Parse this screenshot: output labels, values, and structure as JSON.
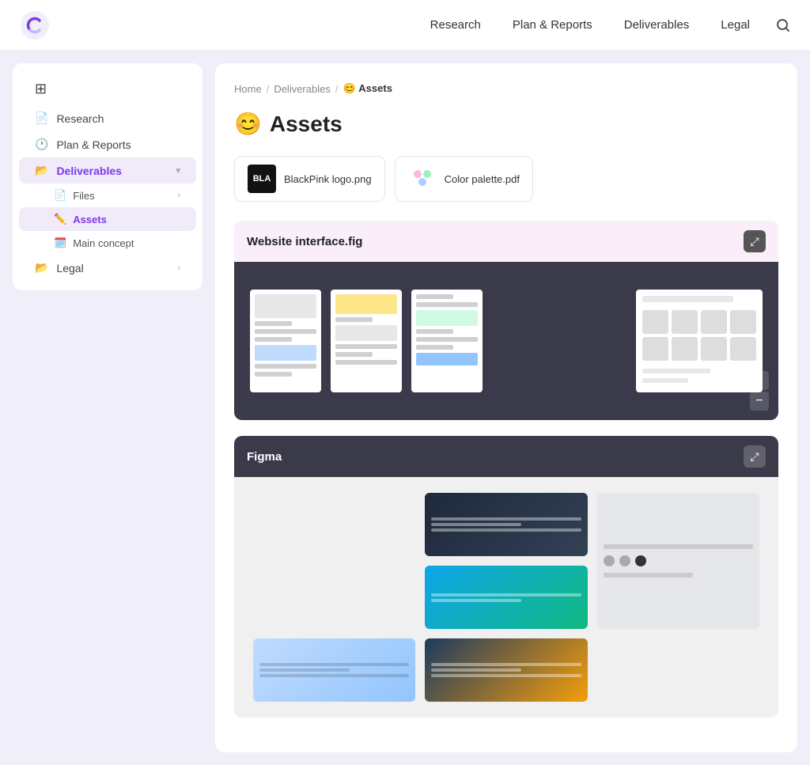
{
  "app": {
    "logo_text": "C"
  },
  "header": {
    "nav": [
      {
        "label": "Research",
        "id": "research"
      },
      {
        "label": "Plan & Reports",
        "id": "plan-reports"
      },
      {
        "label": "Deliverables",
        "id": "deliverables"
      },
      {
        "label": "Legal",
        "id": "legal"
      }
    ],
    "search_label": "Search"
  },
  "sidebar": {
    "icon_item": {
      "label": ""
    },
    "items": [
      {
        "label": "Research",
        "id": "research",
        "icon": "📄"
      },
      {
        "label": "Plan & Reports",
        "id": "plan-reports",
        "icon": "🕐"
      },
      {
        "label": "Deliverables",
        "id": "deliverables",
        "icon": "📂"
      },
      {
        "label": "Legal",
        "id": "legal",
        "icon": "📂"
      }
    ],
    "sub_items": [
      {
        "label": "Files",
        "id": "files",
        "icon": "📄"
      },
      {
        "label": "Assets",
        "id": "assets",
        "icon": "✏️"
      },
      {
        "label": "Main concept",
        "id": "main-concept",
        "icon": "🗓️"
      }
    ]
  },
  "breadcrumb": {
    "home": "Home",
    "sep1": "/",
    "deliverables": "Deliverables",
    "sep2": "/",
    "current": "Assets"
  },
  "page": {
    "title": "Assets",
    "emoji": "😊"
  },
  "files": [
    {
      "name": "BlackPink logo.png",
      "icon_text": "BLA"
    },
    {
      "name": "Color palette.pdf",
      "icon_emoji": "🎨"
    }
  ],
  "sections": [
    {
      "id": "website-interface",
      "title": "Website interface.fig",
      "theme": "light"
    },
    {
      "id": "figma",
      "title": "Figma",
      "theme": "dark"
    }
  ],
  "zoom": {
    "plus": "+",
    "minus": "−"
  },
  "expand_icon": "⤢"
}
